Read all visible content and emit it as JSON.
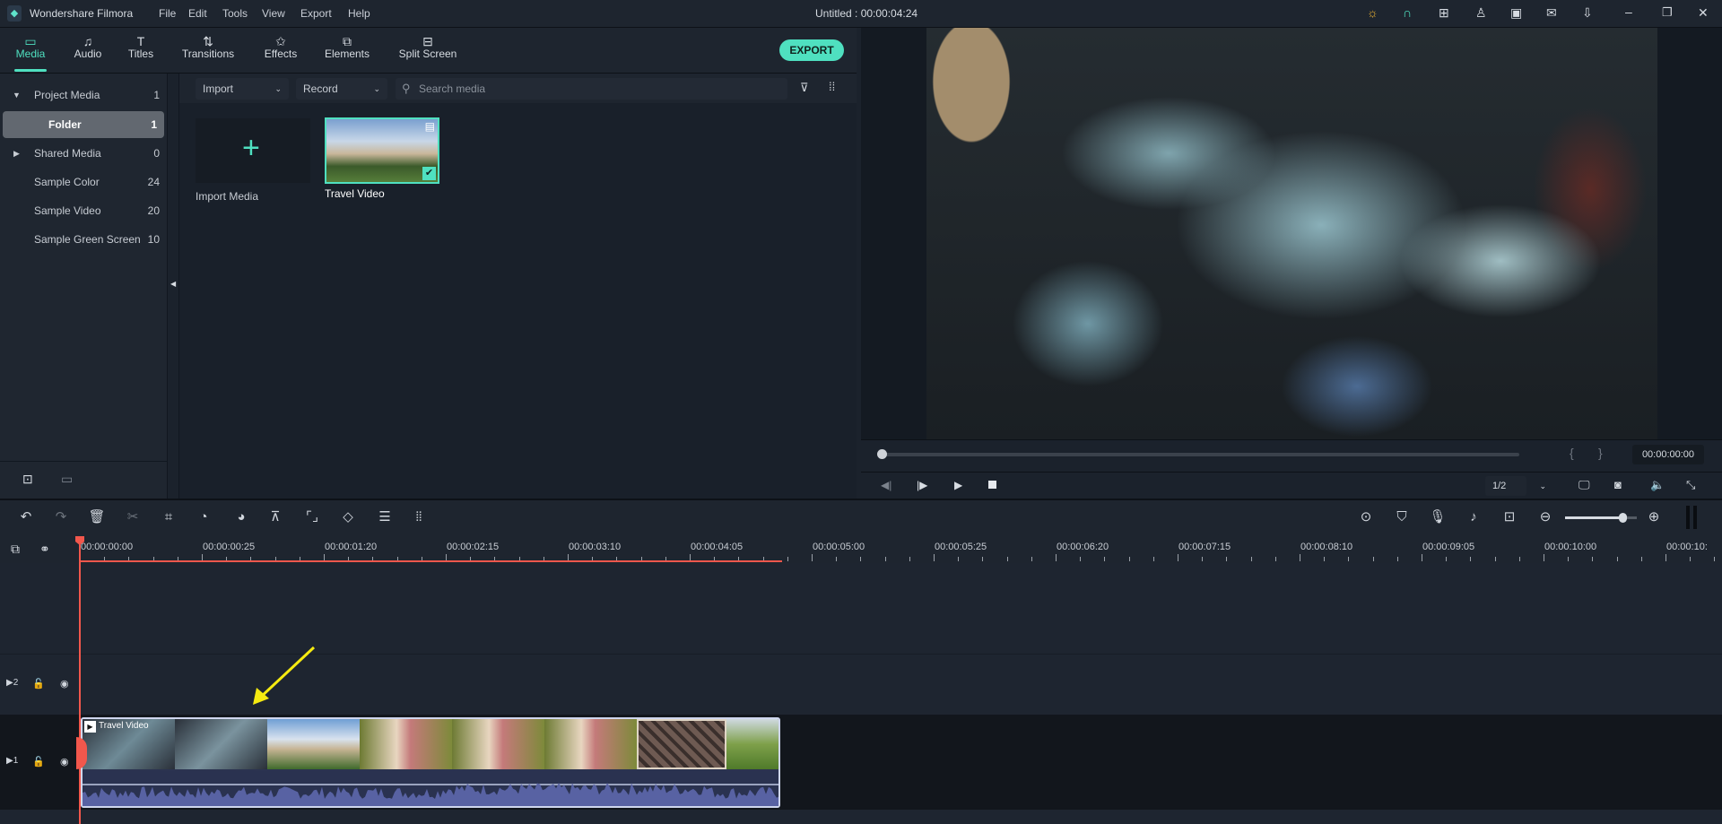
{
  "app": {
    "name": "Wondershare Filmora",
    "title": "Untitled : 00:00:04:24",
    "menu": [
      "File",
      "Edit",
      "Tools",
      "View",
      "Export",
      "Help"
    ]
  },
  "tabs": [
    {
      "label": "Media",
      "icon": "folder-icon"
    },
    {
      "label": "Audio",
      "icon": "music-note-icon"
    },
    {
      "label": "Titles",
      "icon": "text-icon"
    },
    {
      "label": "Transitions",
      "icon": "transitions-icon"
    },
    {
      "label": "Effects",
      "icon": "effects-icon"
    },
    {
      "label": "Elements",
      "icon": "elements-icon"
    },
    {
      "label": "Split Screen",
      "icon": "split-screen-icon"
    }
  ],
  "export_label": "EXPORT",
  "sidebar": {
    "items": [
      {
        "label": "Project Media",
        "count": "1"
      },
      {
        "label": "Folder",
        "count": "1"
      },
      {
        "label": "Shared Media",
        "count": "0"
      },
      {
        "label": "Sample Color",
        "count": "24"
      },
      {
        "label": "Sample Video",
        "count": "20"
      },
      {
        "label": "Sample Green Screen",
        "count": "10"
      }
    ]
  },
  "media": {
    "import_label": "Import",
    "record_label": "Record",
    "search_placeholder": "Search media",
    "items": [
      {
        "label": "Import Media"
      },
      {
        "label": "Travel Video"
      }
    ]
  },
  "preview": {
    "timecode": "00:00:00:00",
    "quality": "1/2",
    "progress": 0
  },
  "timeline": {
    "ruler": [
      "00:00:00:00",
      "00:00:00:25",
      "00:00:01:20",
      "00:00:02:15",
      "00:00:03:10",
      "00:00:04:05",
      "00:00:05:00",
      "00:00:05:25",
      "00:00:06:20",
      "00:00:07:15",
      "00:00:08:10",
      "00:00:09:05",
      "00:00:10:00",
      "00:00:10:"
    ],
    "tracks": [
      {
        "label": "2"
      },
      {
        "label": "1"
      }
    ],
    "clip_label": "Travel Video",
    "zoom_level": 0.8
  },
  "colors": {
    "accent": "#4fe0c0",
    "playhead": "#f2574c",
    "annotation_arrow": "#f5ea10"
  }
}
